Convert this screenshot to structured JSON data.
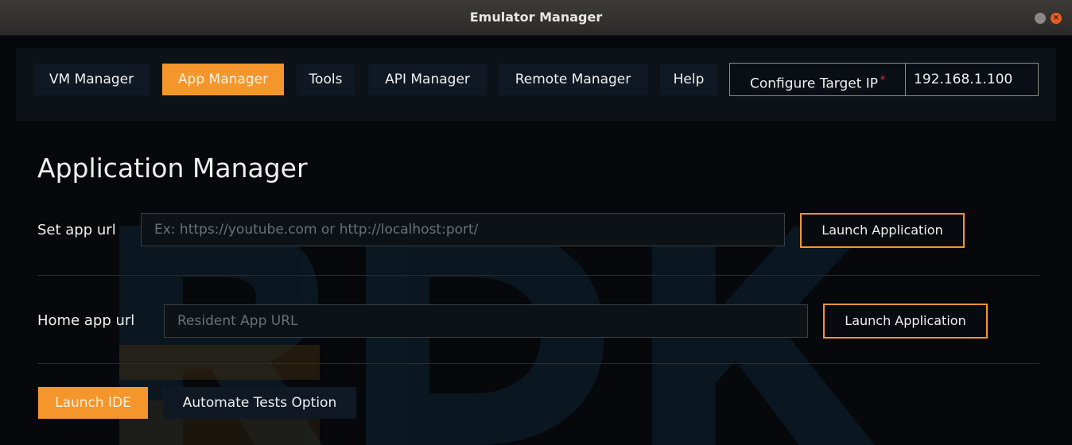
{
  "window": {
    "title": "Emulator Manager",
    "close_glyph": "×"
  },
  "nav": {
    "items": [
      {
        "label": "VM Manager"
      },
      {
        "label": "App Manager"
      },
      {
        "label": "Tools"
      },
      {
        "label": "API Manager"
      },
      {
        "label": "Remote Manager"
      },
      {
        "label": "Help"
      }
    ],
    "active_index": 1,
    "target_ip": {
      "label": "Configure Target IP",
      "required_mark": "*",
      "value": "192.168.1.100"
    }
  },
  "main": {
    "title": "Application Manager",
    "app_url": {
      "label": "Set app url",
      "value": "",
      "placeholder": "Ex: https://youtube.com or http://localhost:port/",
      "button_label": "Launch Application"
    },
    "home_url": {
      "label": "Home app url",
      "value": "",
      "placeholder": "Resident App URL",
      "button_label": "Launch Application"
    },
    "launch_ide_label": "Launch IDE",
    "automate_tests_label": "Automate Tests Option"
  },
  "colors": {
    "accent": "#f5962c",
    "background": "#050608",
    "nav_button": "#101823",
    "required": "#e83a3a"
  },
  "icons": {
    "minimize": "minimize-icon",
    "close": "close-icon"
  }
}
